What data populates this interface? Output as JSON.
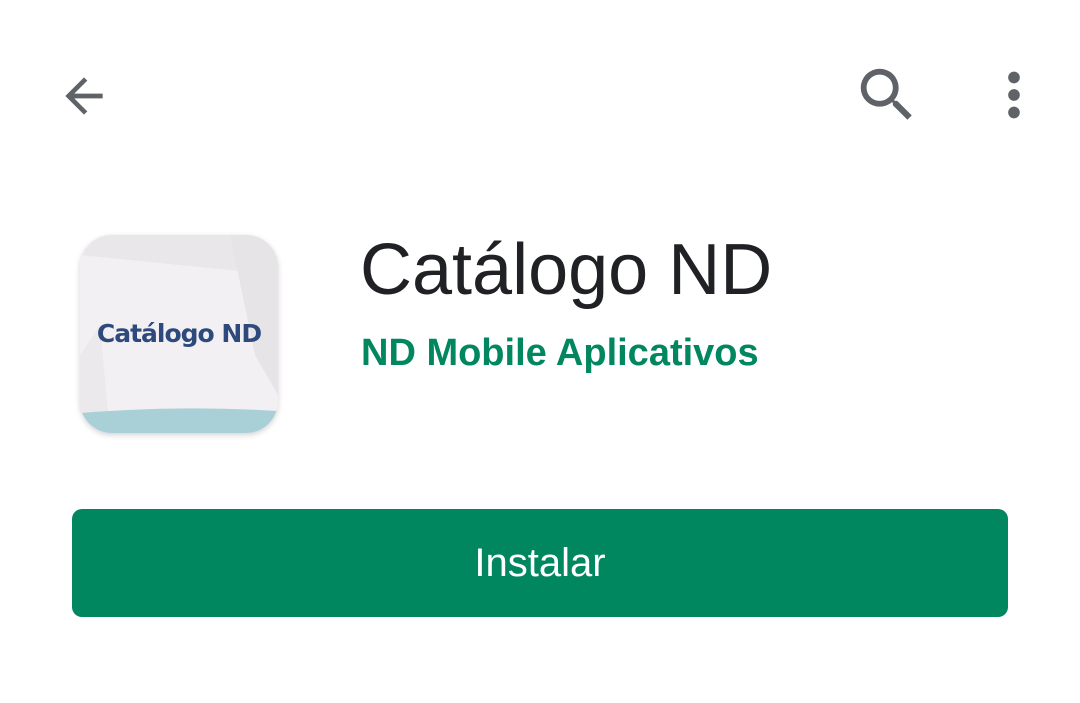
{
  "toolbar": {
    "back_icon": "arrow-back-icon",
    "search_icon": "search-icon",
    "more_icon": "more-vert-icon"
  },
  "app": {
    "name": "Catálogo ND",
    "developer": "ND Mobile Aplicativos",
    "icon_text": "Catálogo ND"
  },
  "install_button": {
    "label": "Instalar"
  },
  "colors": {
    "accent": "#01875f",
    "title": "#202124",
    "icon_grey": "#5f6368",
    "icon_brand_text": "#2e4a7c"
  }
}
